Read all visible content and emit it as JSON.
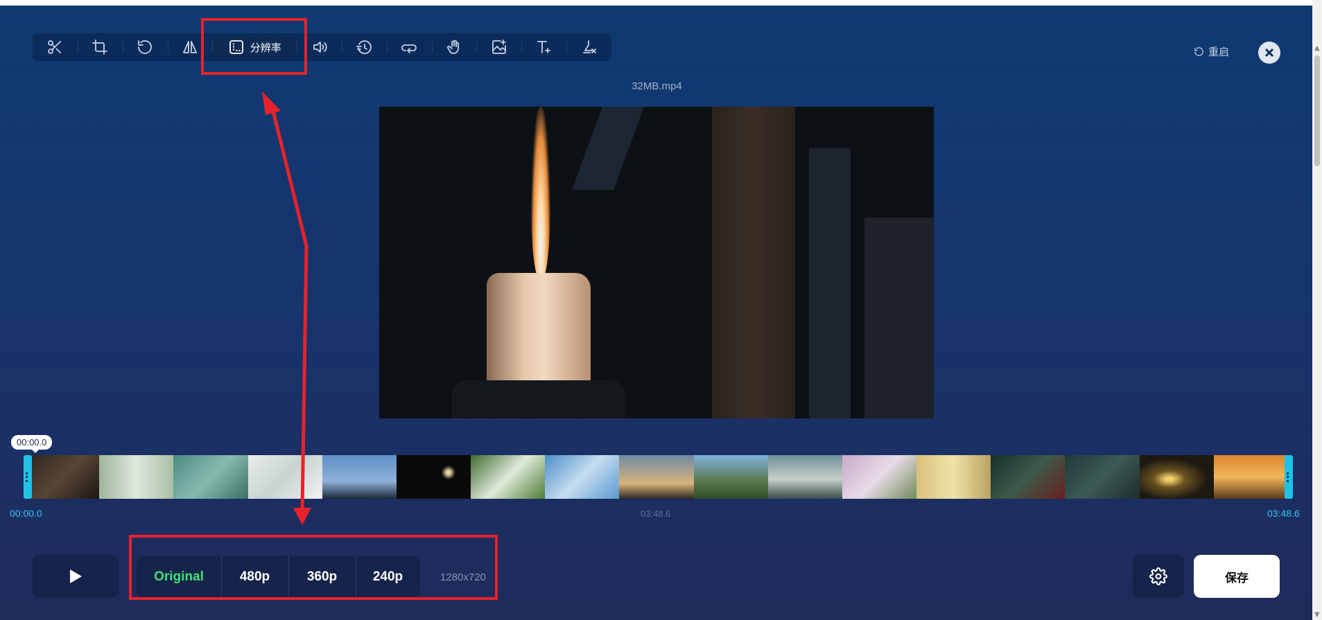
{
  "toolbar": {
    "tools": [
      {
        "name": "scissors-icon"
      },
      {
        "name": "crop-icon"
      },
      {
        "name": "rotate-icon"
      },
      {
        "name": "flip-icon"
      },
      {
        "name": "resolution-icon",
        "label": "分辨率",
        "active": true
      },
      {
        "name": "volume-icon"
      },
      {
        "name": "speed-icon"
      },
      {
        "name": "loop-icon"
      },
      {
        "name": "gesture-icon"
      },
      {
        "name": "add-image-icon"
      },
      {
        "name": "add-text-icon"
      },
      {
        "name": "remove-watermark-icon"
      }
    ],
    "restart_label": "重启"
  },
  "video": {
    "filename": "32MB.mp4"
  },
  "timeline": {
    "playhead_badge": "00:00.0",
    "start_time": "00:00.0",
    "duration_center": "03:48.6",
    "end_time": "03:48.6"
  },
  "resolution": {
    "options": [
      "Original",
      "480p",
      "360p",
      "240p"
    ],
    "selected": "Original",
    "dimensions": "1280x720"
  },
  "actions": {
    "save_label": "保存"
  },
  "colors": {
    "accent_green": "#3fe07a",
    "timeline_cyan": "#31c7f0",
    "annotation_red": "#e8222b",
    "background_top": "#0f3a72",
    "background_bottom": "#202a5a"
  }
}
